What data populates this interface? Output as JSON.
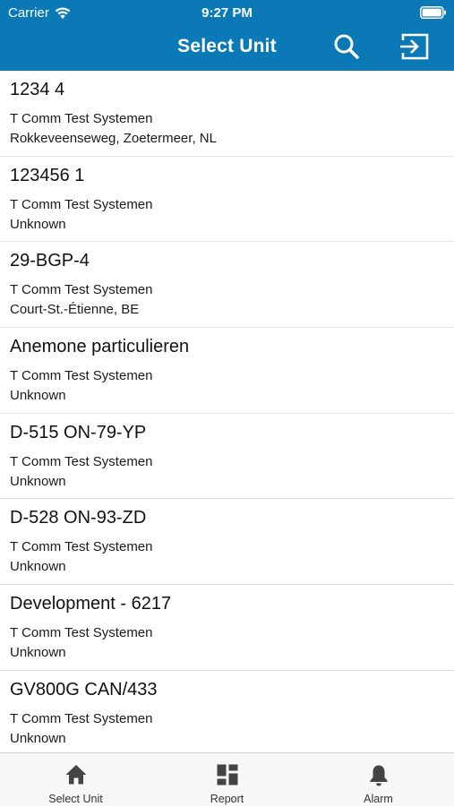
{
  "status_bar": {
    "carrier": "Carrier",
    "time": "9:27 PM"
  },
  "navbar": {
    "title": "Select Unit",
    "search_icon": "search-icon",
    "exit_icon": "exit-icon"
  },
  "units": [
    {
      "name": "1234 4",
      "company": "T Comm Test Systemen",
      "location": "Rokkeveenseweg, Zoetermeer, NL"
    },
    {
      "name": "123456 1",
      "company": "T Comm Test Systemen",
      "location": "Unknown"
    },
    {
      "name": "29-BGP-4",
      "company": "T Comm Test Systemen",
      "location": "Court-St.-Étienne, BE"
    },
    {
      "name": "Anemone particulieren",
      "company": "T Comm Test Systemen",
      "location": "Unknown"
    },
    {
      "name": "D-515 ON-79-YP",
      "company": "T Comm Test Systemen",
      "location": "Unknown"
    },
    {
      "name": "D-528 ON-93-ZD",
      "company": "T Comm Test Systemen",
      "location": "Unknown"
    },
    {
      "name": "Development - 6217",
      "company": "T Comm Test Systemen",
      "location": "Unknown"
    },
    {
      "name": "GV800G CAN/433",
      "company": "T Comm Test Systemen",
      "location": "Unknown"
    }
  ],
  "tabbar": {
    "tabs": [
      {
        "label": "Select Unit",
        "icon": "home-icon"
      },
      {
        "label": "Report",
        "icon": "dashboard-icon"
      },
      {
        "label": "Alarm",
        "icon": "bell-icon"
      }
    ]
  },
  "colors": {
    "header": "#0a79b6",
    "tab_icon": "#444444"
  }
}
